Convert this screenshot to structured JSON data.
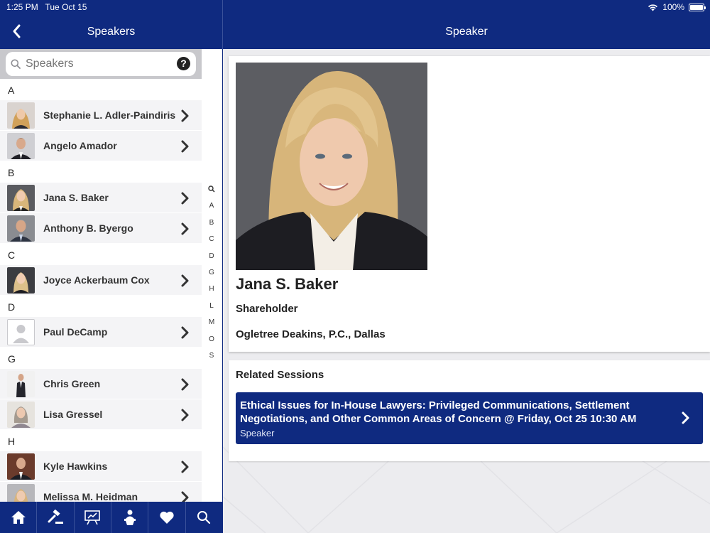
{
  "status": {
    "time": "1:25 PM",
    "date": "Tue Oct 15",
    "battery": "100%",
    "battery_level": 1.0,
    "wifi_icon": "wifi-icon"
  },
  "left_nav": {
    "title": "Speakers",
    "back_icon": "chevron-left-icon"
  },
  "right_nav": {
    "title": "Speaker"
  },
  "search": {
    "placeholder": "Speakers",
    "help_label": "?"
  },
  "sections": [
    {
      "letter": "A",
      "speakers": [
        {
          "name": "Stephanie L. Adler-Paindiris",
          "avatar": "photo"
        },
        {
          "name": "Angelo Amador",
          "avatar": "photo"
        }
      ]
    },
    {
      "letter": "B",
      "speakers": [
        {
          "name": "Jana S. Baker",
          "avatar": "photo"
        },
        {
          "name": "Anthony B. Byergo",
          "avatar": "photo"
        }
      ]
    },
    {
      "letter": "C",
      "speakers": [
        {
          "name": "Joyce Ackerbaum Cox",
          "avatar": "photo"
        }
      ]
    },
    {
      "letter": "D",
      "speakers": [
        {
          "name": "Paul DeCamp",
          "avatar": "placeholder"
        }
      ]
    },
    {
      "letter": "G",
      "speakers": [
        {
          "name": "Chris Green",
          "avatar": "photo"
        },
        {
          "name": "Lisa Gressel",
          "avatar": "photo"
        }
      ]
    },
    {
      "letter": "H",
      "speakers": [
        {
          "name": "Kyle Hawkins",
          "avatar": "photo"
        },
        {
          "name": "Melissa M. Heidman",
          "avatar": "photo"
        }
      ]
    }
  ],
  "alpha_index": [
    "A",
    "B",
    "C",
    "D",
    "G",
    "H",
    "L",
    "M",
    "O",
    "S"
  ],
  "tabs": [
    {
      "name": "home",
      "icon": "home-icon"
    },
    {
      "name": "gavel",
      "icon": "gavel-icon"
    },
    {
      "name": "presentation",
      "icon": "presentation-icon"
    },
    {
      "name": "speaker",
      "icon": "speaker-podium-icon"
    },
    {
      "name": "favorites",
      "icon": "heart-icon"
    },
    {
      "name": "search",
      "icon": "search-icon"
    }
  ],
  "speaker": {
    "name": "Jana S. Baker",
    "title": "Shareholder",
    "organization": "Ogletree Deakins, P.C., Dallas"
  },
  "related_sessions": {
    "heading": "Related Sessions",
    "items": [
      {
        "title": "Ethical Issues for In-House Lawyers: Privileged Communications, Settlement Negotiations, and Other Common Areas of Concern @ Friday, Oct 25 10:30 AM",
        "role": "Speaker"
      }
    ]
  },
  "colors": {
    "brand_navy": "#0f2a80",
    "row_bg": "#f4f4f6",
    "panel_bg": "#ececef"
  }
}
